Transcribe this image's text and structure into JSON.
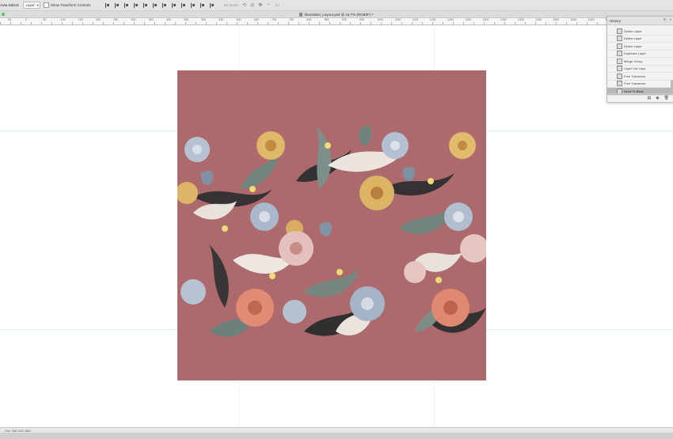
{
  "options_bar": {
    "auto_select_label": "Auto-Select:",
    "layer_select_value": "Layer",
    "show_transform_label": "Show Transform Controls",
    "mode_label": "3D Mode:"
  },
  "document": {
    "tab_title": "Illustration_Layout.psd @ 16.7% (RGB/8*) *"
  },
  "ruler": {
    "ticks": [
      "50",
      "0",
      "50",
      "100",
      "150",
      "200",
      "250",
      "300",
      "350",
      "400",
      "450",
      "500",
      "550",
      "600",
      "650",
      "700",
      "750",
      "800",
      "850",
      "900",
      "950",
      "1000",
      "1050",
      "1100",
      "1150",
      "1200",
      "1250",
      "1300",
      "1350",
      "1400",
      "1450",
      "1500",
      "1550",
      "1600",
      "1650",
      "1700",
      "1750",
      "1800"
    ]
  },
  "history": {
    "title": "History",
    "items": [
      {
        "label": "Delete Layer"
      },
      {
        "label": "Delete Layer"
      },
      {
        "label": "Delete Layer"
      },
      {
        "label": "Duplicate Layer"
      },
      {
        "label": "Merge Group"
      },
      {
        "label": "Layer Via Copy"
      },
      {
        "label": "Free Transform"
      },
      {
        "label": "Free Transform"
      },
      {
        "label": "Send To Back"
      }
    ]
  },
  "status": {
    "doc_size": "Doc: 398.1M/1.86G"
  },
  "colors": {
    "artboard_bg": "#ad6a6c",
    "guide": "#d8f4f4"
  }
}
